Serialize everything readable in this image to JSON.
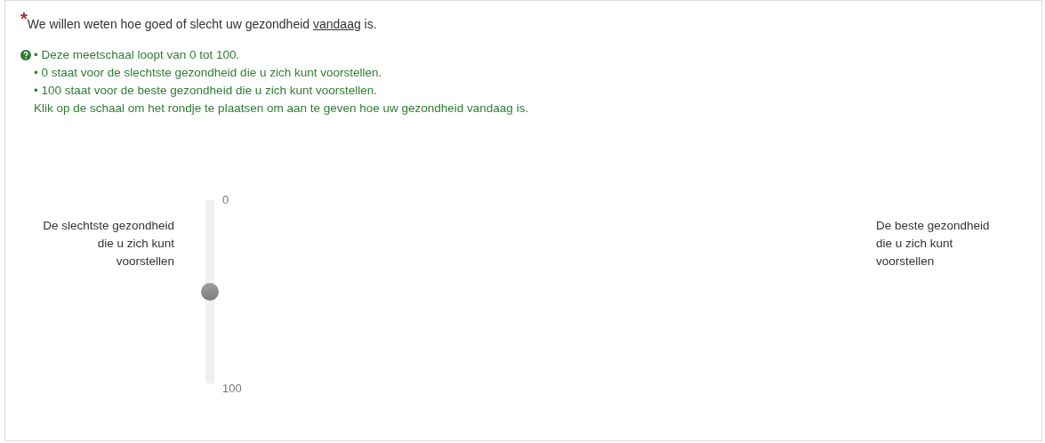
{
  "question": {
    "required_mark": "*",
    "text_before": "We willen weten hoe goed of slecht uw gezondheid ",
    "underlined": "vandaag",
    "text_after": " is."
  },
  "help_lines": [
    "• Deze meetschaal loopt van 0 tot 100.",
    "• 0 staat voor de slechtste gezondheid die u zich kunt voorstellen.",
    "• 100 staat voor de beste gezondheid die u zich kunt voorstellen.",
    "Klik op de schaal om het rondje te plaatsen om aan te geven hoe uw gezondheid vandaag is."
  ],
  "scale": {
    "left_label": "De slechtste gezondheid die u zich kunt voorstellen",
    "right_label": "De beste gezondheid die u zich kunt voorstellen",
    "top_value": "0",
    "bottom_value": "100",
    "level": 0.5
  }
}
